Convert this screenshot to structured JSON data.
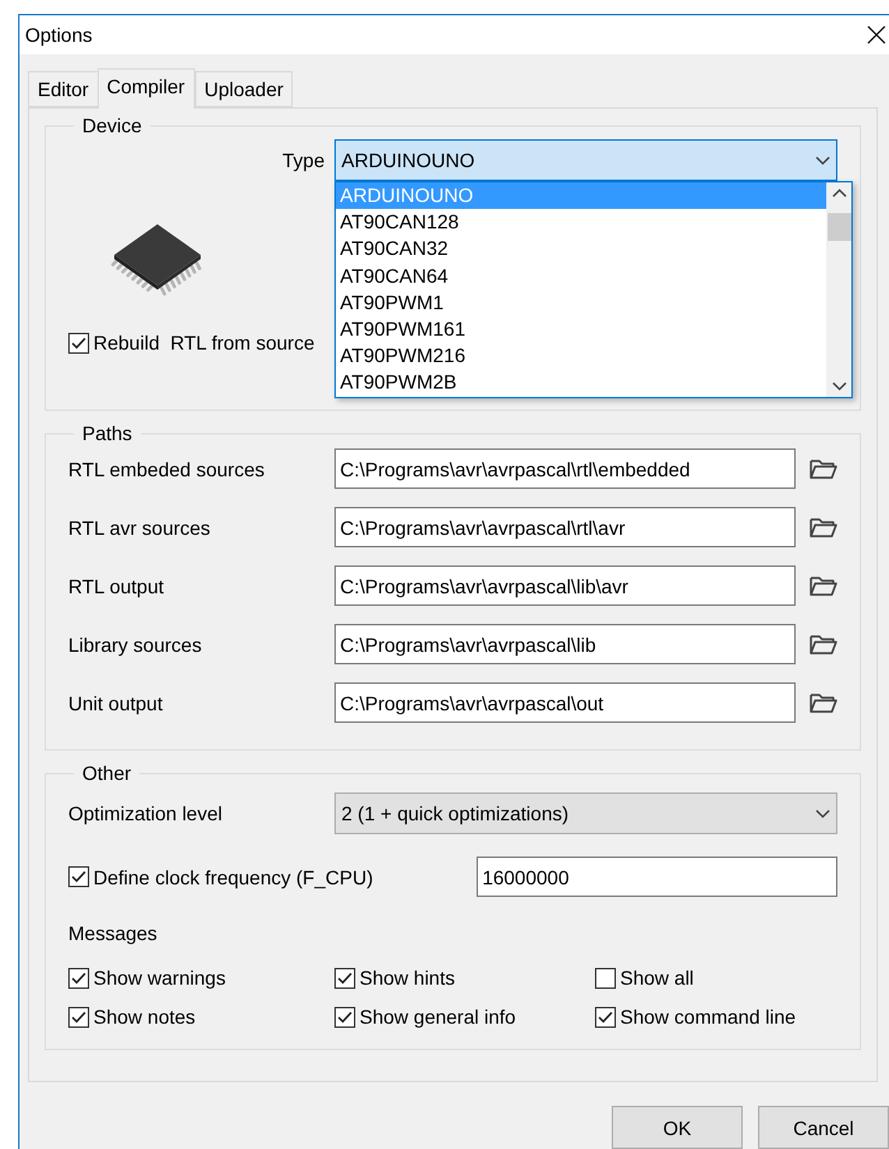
{
  "window": {
    "title": "Options"
  },
  "tabs": [
    {
      "label": "Editor",
      "selected": false
    },
    {
      "label": "Compiler",
      "selected": true
    },
    {
      "label": "Uploader",
      "selected": false
    }
  ],
  "device": {
    "legend": "Device",
    "type_label": "Type",
    "type_value": "ARDUINOUNO",
    "expanded": true,
    "list": [
      {
        "label": "ARDUINOUNO",
        "selected": true
      },
      {
        "label": "AT90CAN128",
        "selected": false
      },
      {
        "label": "AT90CAN32",
        "selected": false
      },
      {
        "label": "AT90CAN64",
        "selected": false
      },
      {
        "label": "AT90PWM1",
        "selected": false
      },
      {
        "label": "AT90PWM161",
        "selected": false
      },
      {
        "label": "AT90PWM216",
        "selected": false
      },
      {
        "label": "AT90PWM2B",
        "selected": false
      }
    ],
    "rebuild": {
      "label": "Rebuild  RTL from source",
      "checked": true
    }
  },
  "paths": {
    "legend": "Paths",
    "rows": [
      {
        "label": "RTL embeded sources",
        "value": "C:\\Programs\\avr\\avrpascal\\rtl\\embedded"
      },
      {
        "label": "RTL avr sources",
        "value": "C:\\Programs\\avr\\avrpascal\\rtl\\avr"
      },
      {
        "label": "RTL output",
        "value": "C:\\Programs\\avr\\avrpascal\\lib\\avr"
      },
      {
        "label": "Library sources",
        "value": "C:\\Programs\\avr\\avrpascal\\lib"
      },
      {
        "label": "Unit output",
        "value": "C:\\Programs\\avr\\avrpascal\\out"
      }
    ]
  },
  "other": {
    "legend": "Other",
    "optimization": {
      "label": "Optimization level",
      "value": "2 (1 + quick optimizations)"
    },
    "clock": {
      "label": "Define clock frequency (F_CPU)",
      "checked": true,
      "value": "16000000"
    },
    "messages_label": "Messages",
    "messages": [
      {
        "label": "Show warnings",
        "checked": true
      },
      {
        "label": "Show hints",
        "checked": true
      },
      {
        "label": "Show all",
        "checked": false
      },
      {
        "label": "Show notes",
        "checked": true
      },
      {
        "label": "Show general info",
        "checked": true
      },
      {
        "label": "Show command line",
        "checked": true
      }
    ]
  },
  "buttons": [
    "OK",
    "Cancel"
  ]
}
